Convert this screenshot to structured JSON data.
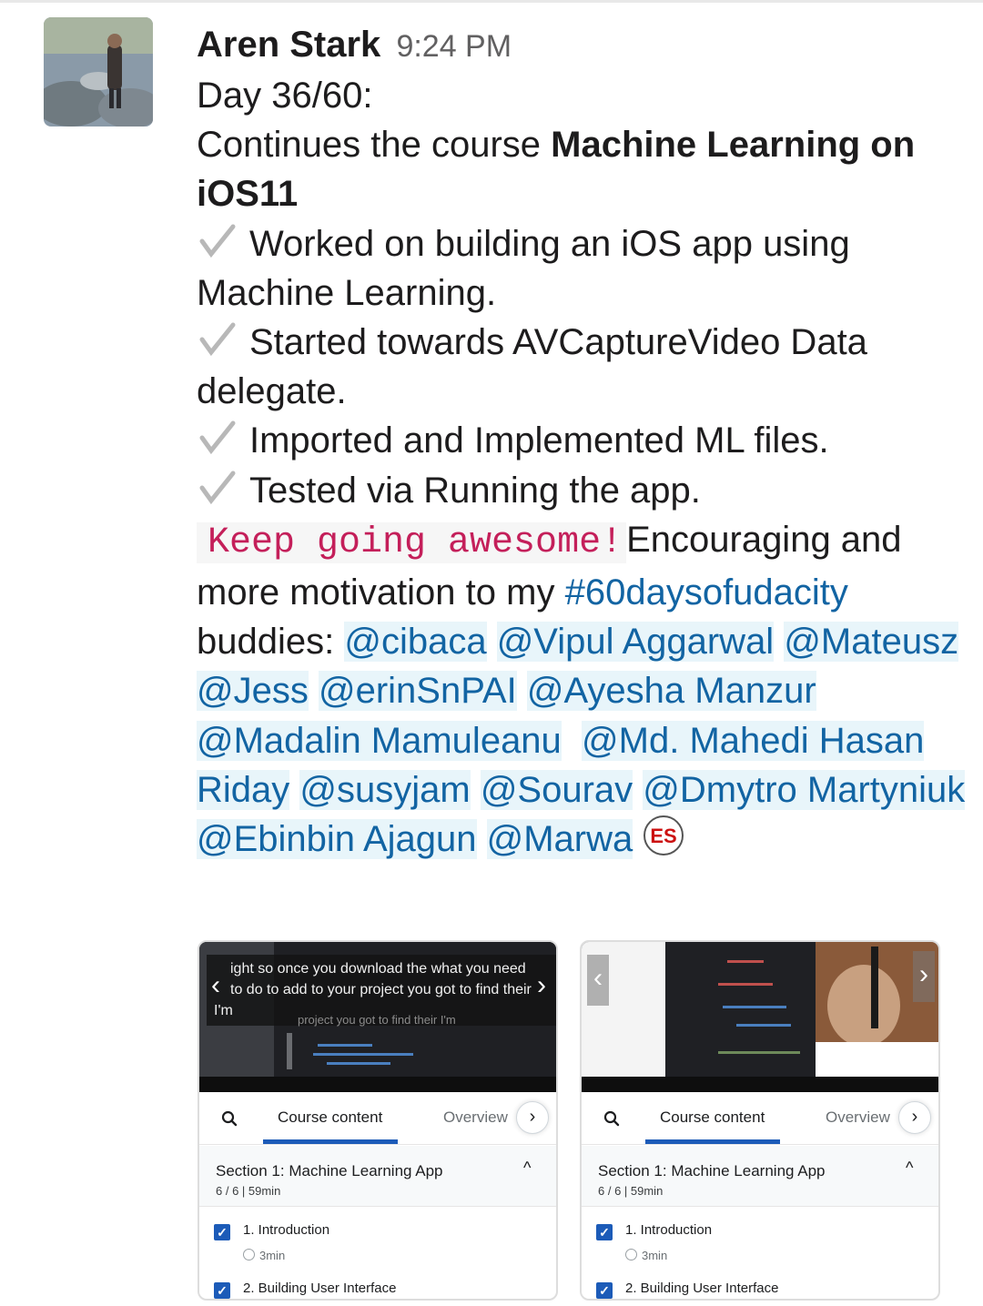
{
  "message": {
    "author": "Aren Stark",
    "time": "9:24 PM",
    "line1": "Day 36/60:",
    "line2_pre": "Continues the course ",
    "line2_bold": "Machine Learning on iOS11",
    "bullets": [
      "Worked on building an iOS app using Machine Learning.",
      "Started towards AVCaptureVideo Data delegate.",
      "Imported and Implemented ML files.",
      "Tested via Running the app."
    ],
    "code_text": "Keep going awesome!",
    "after_code": "Encouraging and more motivation to my",
    "hashtag": "#60daysofudacity",
    "buddies_label": " buddies: ",
    "mentions": [
      "@cibaca",
      "@Vipul Aggarwal",
      "@Mateusz",
      "@Jess",
      "@erinSnPAI",
      "@Ayesha Manzur",
      "@Madalin Mamuleanu",
      "@Md. Mahedi Hasan Riday",
      "@susyjam",
      "@Sourav",
      "@Dmytro Martyniuk",
      "@Ebinbin Ajagun",
      "@Marwa"
    ],
    "emoji_text": "ES"
  },
  "cards": [
    {
      "caption_line1": "ight so once you download the what you need",
      "caption_line2": "to do to add to your project you got to find their",
      "caption_line3": "I'm",
      "caption_ghost": "project you got to find their I'm",
      "tab_course": "Course content",
      "tab_overview": "Overview",
      "section_title": "Section 1: Machine Learning App",
      "section_meta": "6 / 6 | 59min",
      "items": [
        {
          "title": "1. Introduction",
          "duration": "3min"
        },
        {
          "title": "2. Building User Interface",
          "duration": ""
        }
      ]
    },
    {
      "caption_line1": "",
      "caption_line2": "",
      "caption_line3": "",
      "caption_ghost": "",
      "tab_course": "Course content",
      "tab_overview": "Overview",
      "section_title": "Section 1: Machine Learning App",
      "section_meta": "6 / 6 | 59min",
      "items": [
        {
          "title": "1. Introduction",
          "duration": "3min"
        },
        {
          "title": "2. Building User Interface",
          "duration": ""
        }
      ]
    }
  ],
  "colors": {
    "mention": "#1264a3",
    "mention_bg": "#e8f5fa",
    "code": "#c41f5a",
    "accent": "#1c5bb8"
  }
}
